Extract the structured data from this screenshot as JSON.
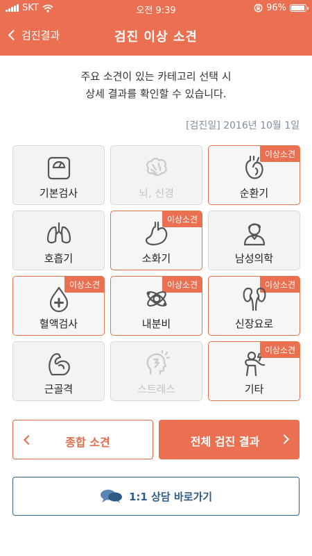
{
  "status_bar": {
    "carrier": "SKT",
    "time": "오전 9:39",
    "battery": "96%",
    "battery_level": 0.96,
    "icons": [
      "signal-bars-icon",
      "wifi-icon",
      "rotation-lock-icon",
      "battery-icon"
    ]
  },
  "nav": {
    "back_label": "검진결과",
    "title": "검진 이상 소견"
  },
  "intro": {
    "line1": "주요 소견이 있는 카테고리 선택 시",
    "line2": "상세 결과를 확인할 수 있습니다."
  },
  "checkup_date": "[검진일] 2016년 10월 1일",
  "badge_label": "이상소견",
  "categories": [
    {
      "label": "기본검사",
      "icon": "scale-icon",
      "abnormal": false,
      "enabled": true
    },
    {
      "label": "뇌, 신경",
      "icon": "brain-icon",
      "abnormal": false,
      "enabled": false
    },
    {
      "label": "순환기",
      "icon": "heart-icon",
      "abnormal": true,
      "enabled": true
    },
    {
      "label": "호흡기",
      "icon": "lungs-icon",
      "abnormal": false,
      "enabled": true
    },
    {
      "label": "소화기",
      "icon": "stomach-icon",
      "abnormal": true,
      "enabled": true
    },
    {
      "label": "남성의학",
      "icon": "male-person-icon",
      "abnormal": false,
      "enabled": true
    },
    {
      "label": "혈액검사",
      "icon": "blood-drop-icon",
      "abnormal": true,
      "enabled": true
    },
    {
      "label": "내분비",
      "icon": "molecule-icon",
      "abnormal": true,
      "enabled": true
    },
    {
      "label": "신장요로",
      "icon": "kidneys-icon",
      "abnormal": true,
      "enabled": true
    },
    {
      "label": "근골격",
      "icon": "arm-muscle-icon",
      "abnormal": false,
      "enabled": true
    },
    {
      "label": "스트레스",
      "icon": "stressed-head-icon",
      "abnormal": false,
      "enabled": false
    },
    {
      "label": "기타",
      "icon": "body-pain-icon",
      "abnormal": true,
      "enabled": true
    }
  ],
  "buttons": {
    "summary": "종합 소견",
    "full_results": "전체 검진 결과",
    "consult": "1:1 상담 바로가기"
  },
  "colors": {
    "accent": "#ea7051",
    "consult_blue": "#2f5b86",
    "date_gray": "#7f8e9e"
  }
}
